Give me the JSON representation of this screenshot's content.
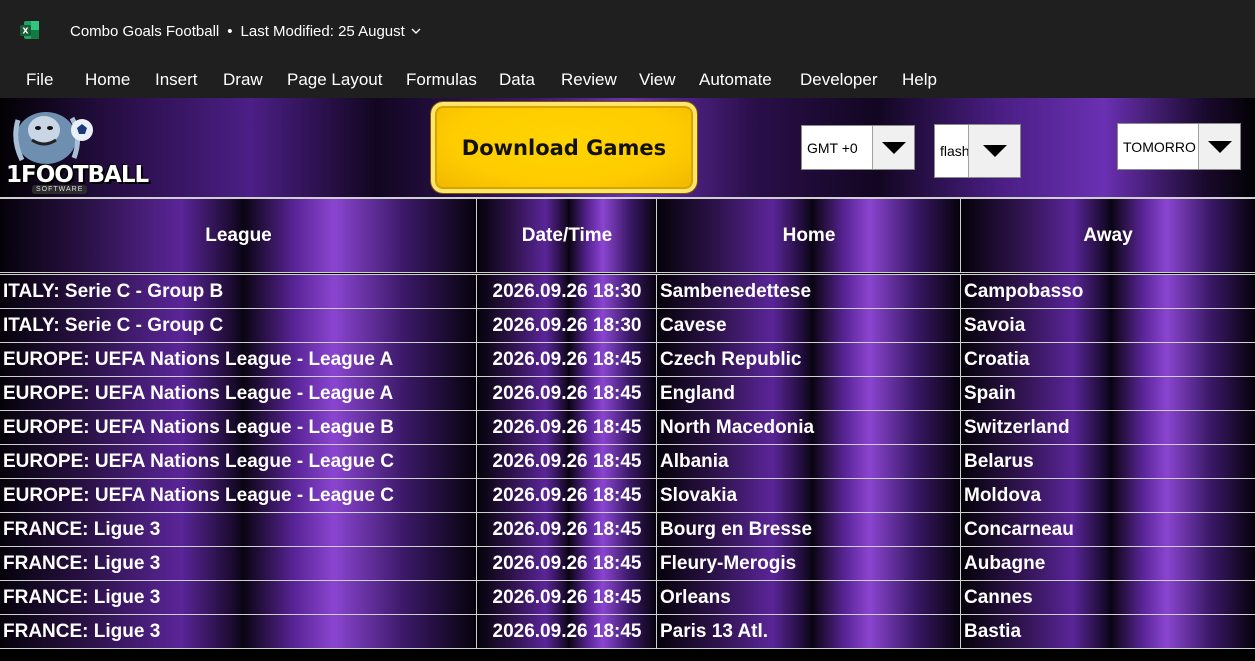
{
  "window": {
    "title": "Combo Goals Football",
    "separator": "•",
    "last_modified": "Last Modified: 25 August",
    "app_icon": "excel-icon"
  },
  "menu": [
    "File",
    "Home",
    "Insert",
    "Draw",
    "Page Layout",
    "Formulas",
    "Data",
    "Review",
    "View",
    "Automate",
    "Developer",
    "Help"
  ],
  "banner": {
    "logo_text": "1FOOTBALL",
    "logo_sub": "SOFTWARE",
    "download_label": "Download Games",
    "timezone": "GMT +0",
    "source": "flash",
    "day": "TOMORRO"
  },
  "table": {
    "headers": [
      "League",
      "Date/Time",
      "Home",
      "Away"
    ],
    "rows": [
      {
        "league": "ITALY: Serie C - Group B",
        "datetime": "2026.09.26 18:30",
        "home": "Sambenedettese",
        "away": "Campobasso"
      },
      {
        "league": "ITALY: Serie C - Group C",
        "datetime": "2026.09.26 18:30",
        "home": "Cavese",
        "away": "Savoia"
      },
      {
        "league": "EUROPE: UEFA Nations League - League A",
        "datetime": "2026.09.26 18:45",
        "home": "Czech Republic",
        "away": "Croatia"
      },
      {
        "league": "EUROPE: UEFA Nations League - League A",
        "datetime": "2026.09.26 18:45",
        "home": "England",
        "away": "Spain"
      },
      {
        "league": "EUROPE: UEFA Nations League - League B",
        "datetime": "2026.09.26 18:45",
        "home": "North Macedonia",
        "away": "Switzerland"
      },
      {
        "league": "EUROPE: UEFA Nations League - League C",
        "datetime": "2026.09.26 18:45",
        "home": "Albania",
        "away": "Belarus"
      },
      {
        "league": "EUROPE: UEFA Nations League - League C",
        "datetime": "2026.09.26 18:45",
        "home": "Slovakia",
        "away": "Moldova"
      },
      {
        "league": "FRANCE: Ligue 3",
        "datetime": "2026.09.26 18:45",
        "home": "Bourg en Bresse",
        "away": "Concarneau"
      },
      {
        "league": "FRANCE: Ligue 3",
        "datetime": "2026.09.26 18:45",
        "home": "Fleury-Merogis",
        "away": "Aubagne"
      },
      {
        "league": "FRANCE: Ligue 3",
        "datetime": "2026.09.26 18:45",
        "home": "Orleans",
        "away": "Cannes"
      },
      {
        "league": "FRANCE: Ligue 3",
        "datetime": "2026.09.26 18:45",
        "home": "Paris 13 Atl.",
        "away": "Bastia"
      }
    ]
  },
  "colors": {
    "accent_purple": "#6a30b2",
    "button_yellow": "#ffcc00",
    "titlebar": "#1f1f1f"
  }
}
